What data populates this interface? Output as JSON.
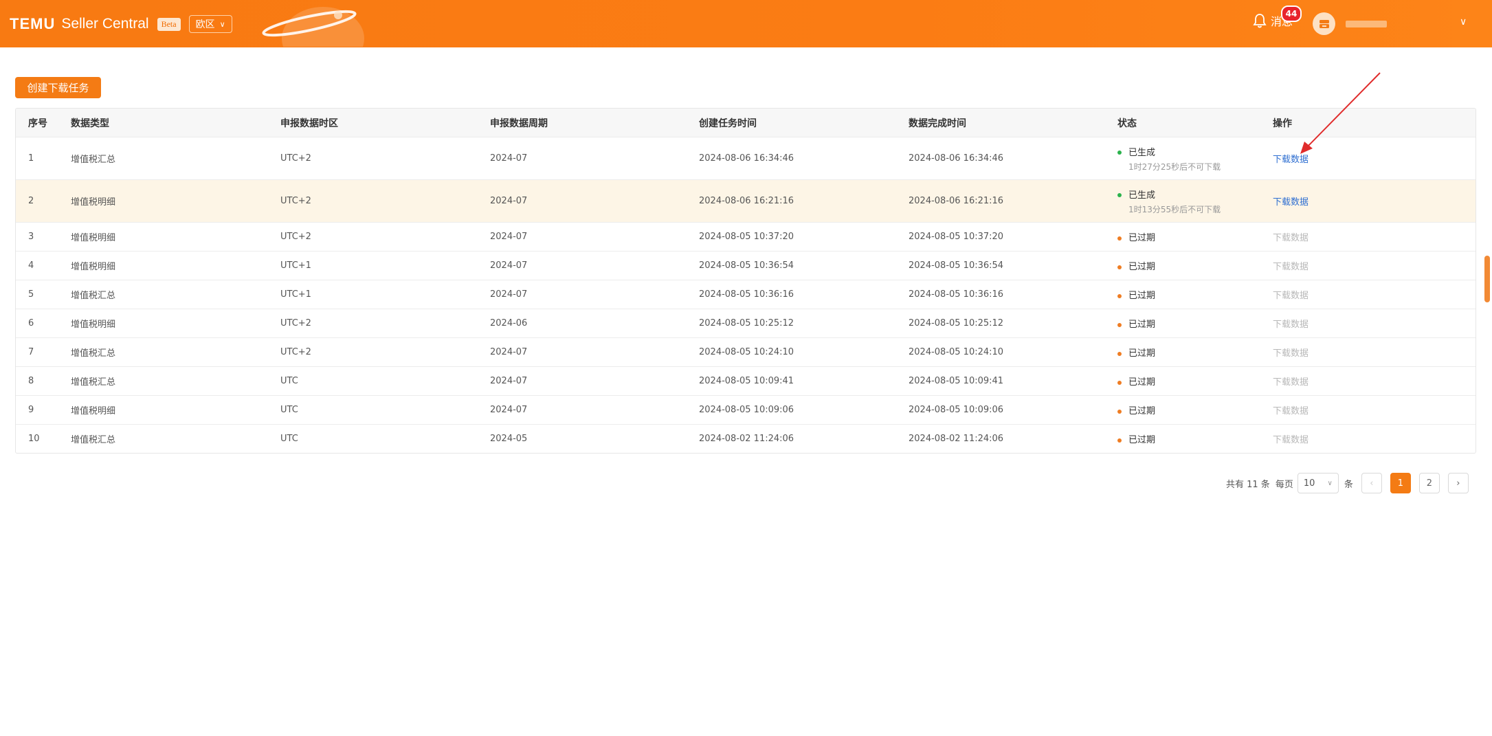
{
  "header": {
    "brand": "TEMU",
    "product": "Seller Central",
    "beta": "Beta",
    "region": "欧区",
    "messages_label": "消息",
    "messages_count": "44",
    "colors": {
      "bar": "#fb7c14",
      "badge": "#e8232c"
    }
  },
  "toolbar": {
    "create_label": "创建下载任务"
  },
  "table": {
    "headers": [
      "序号",
      "数据类型",
      "申报数据时区",
      "申报数据周期",
      "创建任务时间",
      "数据完成时间",
      "状态",
      "操作"
    ],
    "rows": [
      {
        "idx": "1",
        "type": "增值税汇总",
        "tz": "UTC+2",
        "period": "2024-07",
        "created": "2024-08-06 16:34:46",
        "done": "2024-08-06 16:34:46",
        "status": "已生成",
        "sub": "1时27分25秒后不可下载",
        "action": "下载数据"
      },
      {
        "idx": "2",
        "type": "增值税明细",
        "tz": "UTC+2",
        "period": "2024-07",
        "created": "2024-08-06 16:21:16",
        "done": "2024-08-06 16:21:16",
        "status": "已生成",
        "sub": "1时13分55秒后不可下载",
        "action": "下载数据"
      },
      {
        "idx": "3",
        "type": "增值税明细",
        "tz": "UTC+2",
        "period": "2024-07",
        "created": "2024-08-05 10:37:20",
        "done": "2024-08-05 10:37:20",
        "status": "已过期",
        "sub": "",
        "action": "下载数据"
      },
      {
        "idx": "4",
        "type": "增值税明细",
        "tz": "UTC+1",
        "period": "2024-07",
        "created": "2024-08-05 10:36:54",
        "done": "2024-08-05 10:36:54",
        "status": "已过期",
        "sub": "",
        "action": "下载数据"
      },
      {
        "idx": "5",
        "type": "增值税汇总",
        "tz": "UTC+1",
        "period": "2024-07",
        "created": "2024-08-05 10:36:16",
        "done": "2024-08-05 10:36:16",
        "status": "已过期",
        "sub": "",
        "action": "下载数据"
      },
      {
        "idx": "6",
        "type": "增值税明细",
        "tz": "UTC+2",
        "period": "2024-06",
        "created": "2024-08-05 10:25:12",
        "done": "2024-08-05 10:25:12",
        "status": "已过期",
        "sub": "",
        "action": "下载数据"
      },
      {
        "idx": "7",
        "type": "增值税汇总",
        "tz": "UTC+2",
        "period": "2024-07",
        "created": "2024-08-05 10:24:10",
        "done": "2024-08-05 10:24:10",
        "status": "已过期",
        "sub": "",
        "action": "下载数据"
      },
      {
        "idx": "8",
        "type": "增值税汇总",
        "tz": "UTC",
        "period": "2024-07",
        "created": "2024-08-05 10:09:41",
        "done": "2024-08-05 10:09:41",
        "status": "已过期",
        "sub": "",
        "action": "下载数据"
      },
      {
        "idx": "9",
        "type": "增值税明细",
        "tz": "UTC",
        "period": "2024-07",
        "created": "2024-08-05 10:09:06",
        "done": "2024-08-05 10:09:06",
        "status": "已过期",
        "sub": "",
        "action": "下载数据"
      },
      {
        "idx": "10",
        "type": "增值税汇总",
        "tz": "UTC",
        "period": "2024-05",
        "created": "2024-08-02 11:24:06",
        "done": "2024-08-02 11:24:06",
        "status": "已过期",
        "sub": "",
        "action": "下载数据"
      }
    ]
  },
  "pagination": {
    "total": "共有 11 条",
    "per_page_label": "每页",
    "per_page": "10",
    "unit": "条",
    "pages": [
      "1",
      "2"
    ],
    "current": "1"
  },
  "colors": {
    "accent": "#f47b14",
    "link": "#2f6fd1",
    "ok": "#2bb24c",
    "expired": "#ef7d23",
    "highlight_row": "#fdf5e6"
  }
}
